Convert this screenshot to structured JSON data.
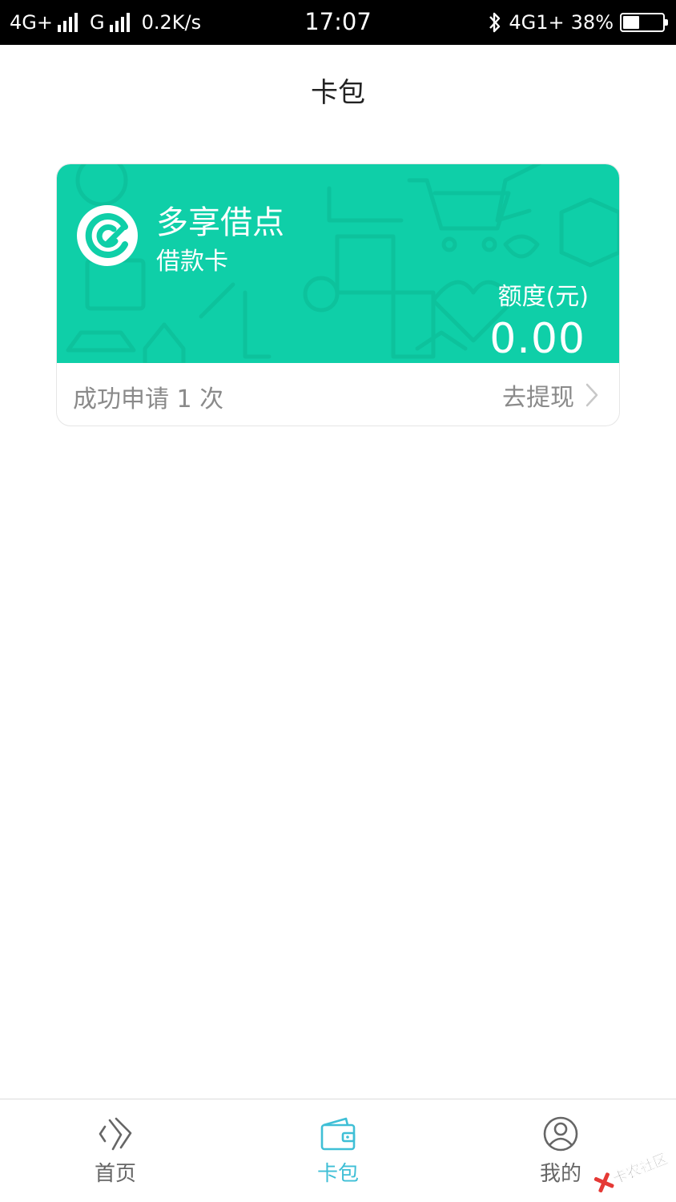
{
  "status_bar": {
    "network_1": "4G+",
    "network_2": "G",
    "speed": "0.2K/s",
    "time": "17:07",
    "network_right": "4G1+",
    "battery": "38%",
    "battery_level": 0.38
  },
  "header": {
    "title": "卡包"
  },
  "card": {
    "name": "多享借点",
    "type": "借款卡",
    "quota_label": "额度(元)",
    "quota_value": "0.00",
    "applied_text": "成功申请 1 次",
    "withdraw_label": "去提现",
    "color": "#0fcfa8"
  },
  "tabs": [
    {
      "label": "首页",
      "icon": "home-icon"
    },
    {
      "label": "卡包",
      "icon": "wallet-icon",
      "active": true
    },
    {
      "label": "我的",
      "icon": "user-icon"
    }
  ],
  "colors": {
    "accent": "#3fbfd6",
    "card_green": "#0fcfa8"
  },
  "watermark": {
    "text": "卡农社区"
  }
}
